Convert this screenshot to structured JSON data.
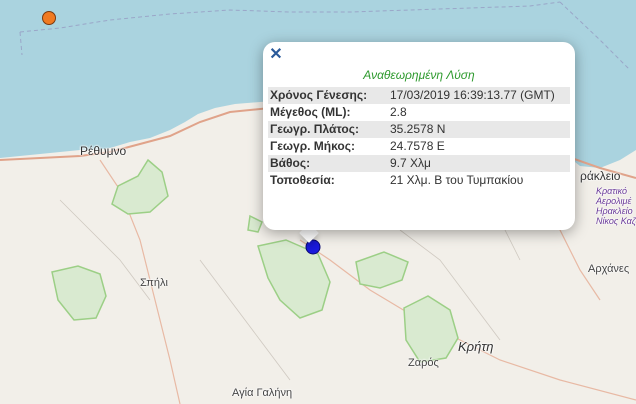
{
  "popup": {
    "close_icon": "close-icon",
    "header": "Αναθεωρημένη Λύση",
    "rows": [
      {
        "label": "Χρόνος Γένεσης:",
        "value": "17/03/2019 16:39:13.77 (GMT)"
      },
      {
        "label": "Μέγεθος (ML):",
        "value": "2.8"
      },
      {
        "label": "Γεωγρ. Πλάτος:",
        "value": "35.2578 N"
      },
      {
        "label": "Γεωγρ. Μήκος:",
        "value": "24.7578 E"
      },
      {
        "label": "Βάθος:",
        "value": "9.7 Χλμ"
      },
      {
        "label": "Τοποθεσία:",
        "value": "21 Χλμ. Β του Τυμπακίου"
      }
    ]
  },
  "places": {
    "rethymno": "Ρέθυμνο",
    "iraklio": "ράκλειο",
    "airport": [
      "Κρατικό",
      "Αερολιμέ",
      "Ηρακλείο",
      "Νίκος Καζαντ"
    ],
    "spili": "Σπήλι",
    "archanes": "Αρχάνες",
    "kriti": "Κρήτη",
    "zaros": "Ζαρός",
    "agia_galini": "Αγία Γαλήνη"
  },
  "markers": {
    "selected_quake_color": "#1a1adb",
    "other_quake_color": "#f07a22"
  },
  "colors": {
    "sea": "#aad3df",
    "land": "#f2efe9",
    "park_fill": "#d9ead0",
    "park_stroke": "#9ccf86"
  }
}
